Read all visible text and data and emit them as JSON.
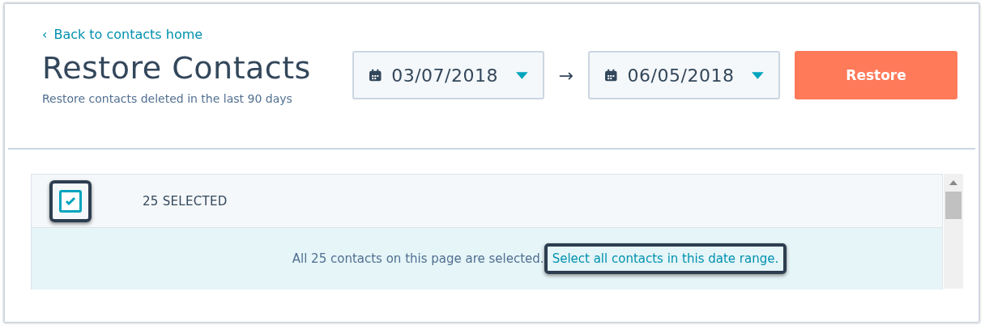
{
  "back_link": {
    "icon": "‹",
    "label": "Back to contacts home"
  },
  "title": "Restore Contacts",
  "subtitle": "Restore contacts deleted in the last 90 days",
  "date_range": {
    "start": "03/07/2018",
    "arrow": "→",
    "end": "06/05/2018"
  },
  "restore_button": "Restore",
  "table": {
    "select_all": {
      "checked": true,
      "highlighted": true
    },
    "selected_count": "25 SELECTED",
    "banner": {
      "message": "All 25 contacts on this page are selected.",
      "link": "Select all contacts in this date range.",
      "link_highlighted": true
    }
  }
}
